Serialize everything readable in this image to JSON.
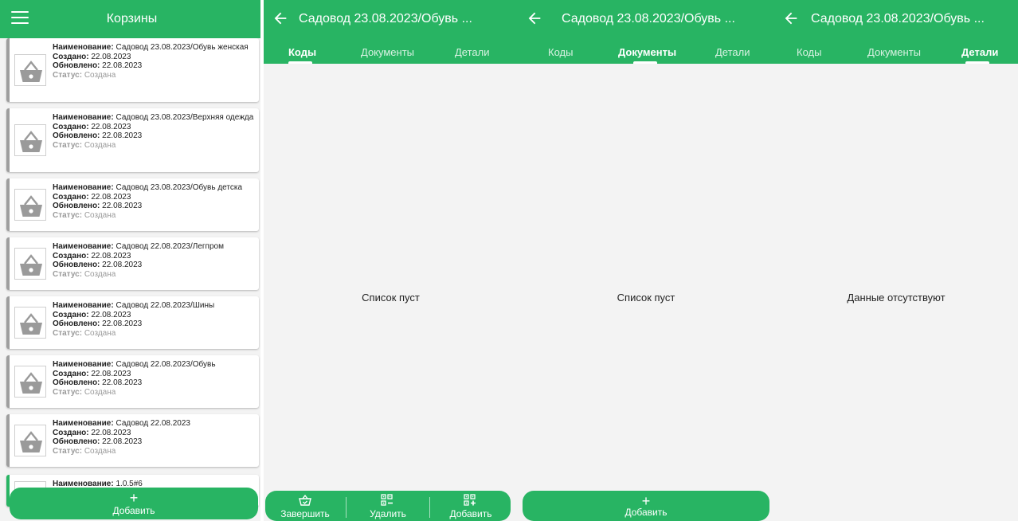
{
  "baskets_screen": {
    "title": "Корзины",
    "items": [
      {
        "name_label": "Наименование:",
        "name": "Садовод 23.08.2023/Обувь женская",
        "created_label": "Создано:",
        "created": "22.08.2023",
        "updated_label": "Обновлено:",
        "updated": "22.08.2023",
        "status_label": "Статус:",
        "status": "Создана"
      },
      {
        "name_label": "Наименование:",
        "name": "Садовод 23.08.2023/Верхняя одежда",
        "created_label": "Создано:",
        "created": "22.08.2023",
        "updated_label": "Обновлено:",
        "updated": "22.08.2023",
        "status_label": "Статус:",
        "status": "Создана"
      },
      {
        "name_label": "Наименование:",
        "name": "Садовод 23.08.2023/Обувь детска",
        "created_label": "Создано:",
        "created": "22.08.2023",
        "updated_label": "Обновлено:",
        "updated": "22.08.2023",
        "status_label": "Статус:",
        "status": "Создана"
      },
      {
        "name_label": "Наименование:",
        "name": "Садовод 22.08.2023/Легпром",
        "created_label": "Создано:",
        "created": "22.08.2023",
        "updated_label": "Обновлено:",
        "updated": "22.08.2023",
        "status_label": "Статус:",
        "status": "Создана"
      },
      {
        "name_label": "Наименование:",
        "name": "Садовод 22.08.2023/Шины",
        "created_label": "Создано:",
        "created": "22.08.2023",
        "updated_label": "Обновлено:",
        "updated": "22.08.2023",
        "status_label": "Статус:",
        "status": "Создана"
      },
      {
        "name_label": "Наименование:",
        "name": "Садовод 22.08.2023/Обувь",
        "created_label": "Создано:",
        "created": "22.08.2023",
        "updated_label": "Обновлено:",
        "updated": "22.08.2023",
        "status_label": "Статус:",
        "status": "Создана"
      },
      {
        "name_label": "Наименование:",
        "name": "Садовод 22.08.2023",
        "created_label": "Создано:",
        "created": "22.08.2023",
        "updated_label": "Обновлено:",
        "updated": "22.08.2023",
        "status_label": "Статус:",
        "status": "Создана"
      },
      {
        "name_label": "Наименование:",
        "name": "1.0.5#6"
      }
    ],
    "add_button": "Добавить"
  },
  "basket_header_title": "Садовод 23.08.2023/Обувь ...",
  "tabs": {
    "codes": "Коды",
    "documents": "Документы",
    "details": "Детали"
  },
  "codes_screen": {
    "empty_text": "Список пуст",
    "bottom_bar": {
      "finish": "Завершить",
      "delete": "Удалить",
      "add": "Добавить"
    }
  },
  "documents_screen": {
    "empty_text": "Список пуст",
    "add_button": "Добавить"
  },
  "details_screen": {
    "empty_text": "Данные отсутствуют"
  },
  "colors": {
    "primary": "#28b463",
    "card_border": "#9e9e9e",
    "status_text": "#9a9a9a"
  },
  "icons": [
    "menu-icon",
    "back-arrow-icon",
    "basket-icon",
    "plus-icon",
    "basket-check-icon",
    "qr-remove-icon",
    "qr-add-icon"
  ]
}
